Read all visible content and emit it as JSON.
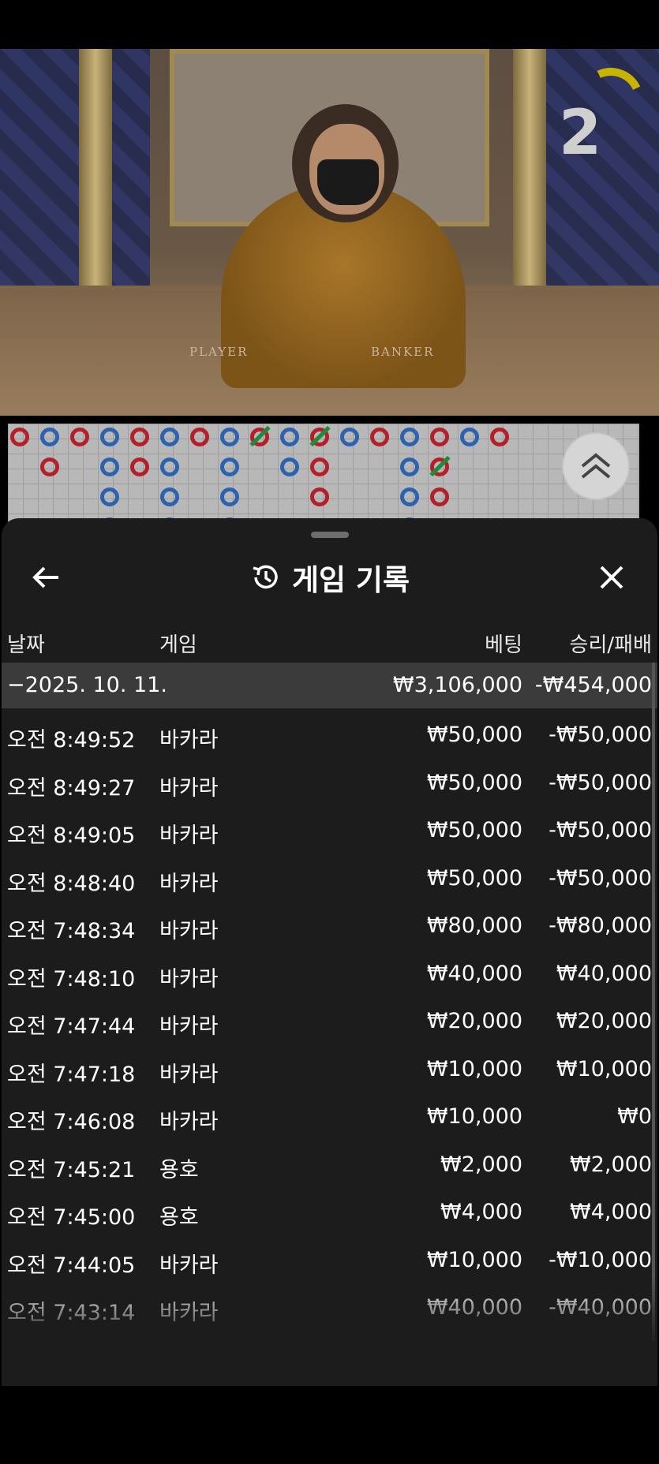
{
  "video": {
    "round_counter": "2",
    "table_labels": {
      "player": "PLAYER",
      "banker": "BANKER"
    }
  },
  "roadmap": {
    "colors": {
      "banker": "#b3202a",
      "player": "#2b63b0",
      "tie": "#1f8a3a"
    }
  },
  "panel": {
    "title": "게임 기록",
    "icons": {
      "back": "arrow-left-icon",
      "history": "history-icon",
      "close": "close-icon",
      "expand": "chevron-double-up-icon"
    },
    "columns": {
      "date": "날짜",
      "game": "게임",
      "bet": "베팅",
      "result": "승리/패배"
    },
    "summary": {
      "date": "−2025. 10. 11.",
      "bet": "₩3,106,000",
      "result": "-₩454,000"
    },
    "rows": [
      {
        "time": "오전 8:49:52",
        "game": "바카라",
        "bet": "₩50,000",
        "result": "-₩50,000"
      },
      {
        "time": "오전 8:49:27",
        "game": "바카라",
        "bet": "₩50,000",
        "result": "-₩50,000"
      },
      {
        "time": "오전 8:49:05",
        "game": "바카라",
        "bet": "₩50,000",
        "result": "-₩50,000"
      },
      {
        "time": "오전 8:48:40",
        "game": "바카라",
        "bet": "₩50,000",
        "result": "-₩50,000"
      },
      {
        "time": "오전 7:48:34",
        "game": "바카라",
        "bet": "₩80,000",
        "result": "-₩80,000"
      },
      {
        "time": "오전 7:48:10",
        "game": "바카라",
        "bet": "₩40,000",
        "result": "₩40,000"
      },
      {
        "time": "오전 7:47:44",
        "game": "바카라",
        "bet": "₩20,000",
        "result": "₩20,000"
      },
      {
        "time": "오전 7:47:18",
        "game": "바카라",
        "bet": "₩10,000",
        "result": "₩10,000"
      },
      {
        "time": "오전 7:46:08",
        "game": "바카라",
        "bet": "₩10,000",
        "result": "₩0"
      },
      {
        "time": "오전 7:45:21",
        "game": "용호",
        "bet": "₩2,000",
        "result": "₩2,000"
      },
      {
        "time": "오전 7:45:00",
        "game": "용호",
        "bet": "₩4,000",
        "result": "₩4,000"
      },
      {
        "time": "오전 7:44:05",
        "game": "바카라",
        "bet": "₩10,000",
        "result": "-₩10,000"
      },
      {
        "time": "오전 7:43:14",
        "game": "바카라",
        "bet": "₩40,000",
        "result": "-₩40,000"
      }
    ]
  }
}
